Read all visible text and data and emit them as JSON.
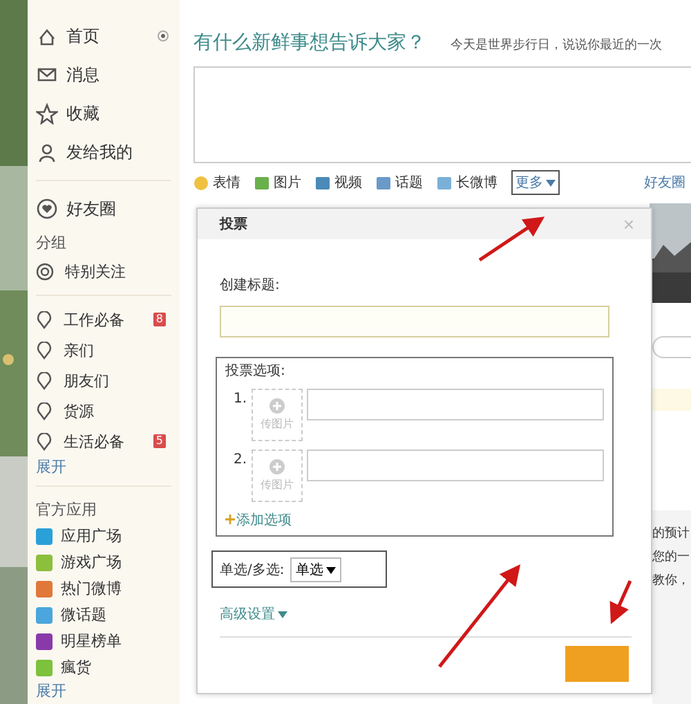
{
  "sidebar": {
    "nav": [
      {
        "label": "首页",
        "selected": true
      },
      {
        "label": "消息",
        "selected": false
      },
      {
        "label": "收藏",
        "selected": false
      },
      {
        "label": "发给我的",
        "selected": false
      }
    ],
    "circle": {
      "label": "好友圈"
    },
    "group_heading": "分组",
    "special": {
      "label": "特别关注"
    },
    "groups": [
      {
        "label": "工作必备",
        "badge": "8"
      },
      {
        "label": "亲们"
      },
      {
        "label": "朋友们"
      },
      {
        "label": "货源"
      },
      {
        "label": "生活必备",
        "badge": "5"
      }
    ],
    "groups_expand": "展开",
    "apps_heading": "官方应用",
    "apps": [
      {
        "label": "应用广场",
        "color": "#2aa0d8"
      },
      {
        "label": "游戏广场",
        "color": "#8bbf3c"
      },
      {
        "label": "热门微博",
        "color": "#e0783a"
      },
      {
        "label": "微话题",
        "color": "#4aa6dc"
      },
      {
        "label": "明星榜单",
        "color": "#8a3aa8"
      },
      {
        "label": "瘋货",
        "color": "#7cc23c"
      }
    ],
    "apps_expand": "展开"
  },
  "composer": {
    "heading": "有什么新鲜事想告诉大家？",
    "hint": "今天是世界步行日，说说你最近的一次",
    "tools": [
      "表情",
      "图片",
      "视频",
      "话题",
      "长微博"
    ],
    "more": "更多",
    "audience": "好友圈"
  },
  "background_fragments": [
    "的预计",
    "您的一",
    "教你，"
  ],
  "dialog": {
    "title": "投票",
    "close": "×",
    "title_label": "创建标题:",
    "options_label": "投票选项:",
    "options": [
      {
        "number": "1.",
        "upload": "传图片"
      },
      {
        "number": "2.",
        "upload": "传图片"
      }
    ],
    "add_option": "添加选项",
    "mode_label": "单选/多选:",
    "mode_value": "单选",
    "advanced": "高级设置"
  }
}
